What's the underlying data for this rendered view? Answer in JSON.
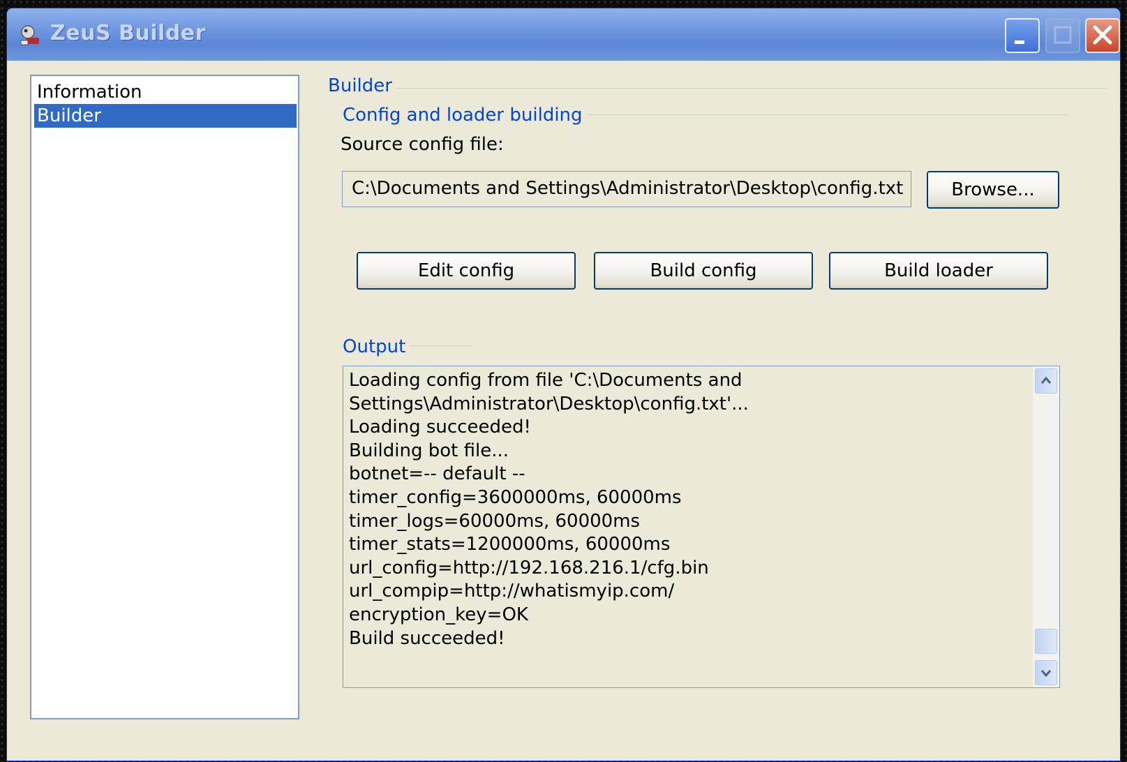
{
  "window": {
    "title": "ZeuS Builder",
    "controls": [
      "minimize-icon",
      "maximize-icon",
      "close-icon"
    ]
  },
  "sidebar": {
    "items": [
      {
        "label": "Information",
        "selected": false
      },
      {
        "label": "Builder",
        "selected": true
      }
    ]
  },
  "main": {
    "section_title": "Builder",
    "group_title": "Config and loader building",
    "source_label": "Source config file:",
    "source_path": "C:\\Documents and Settings\\Administrator\\Desktop\\config.txt",
    "browse_label": "Browse...",
    "edit_config_label": "Edit config",
    "build_config_label": "Build config",
    "build_loader_label": "Build loader",
    "output_title": "Output",
    "output_lines": [
      "Loading config from file 'C:\\Documents and",
      "Settings\\Administrator\\Desktop\\config.txt'...",
      "Loading succeeded!",
      "Building bot file...",
      "botnet=-- default --",
      "timer_config=3600000ms, 60000ms",
      "timer_logs=60000ms, 60000ms",
      "timer_stats=1200000ms, 60000ms",
      "url_config=http://192.168.216.1/cfg.bin",
      "url_compip=http://whatismyip.com/",
      "encryption_key=OK",
      "Build succeeded!"
    ]
  },
  "colors": {
    "selection": "#316ac5",
    "group_text": "#0046d5",
    "window_bg": "#ece9d8"
  }
}
